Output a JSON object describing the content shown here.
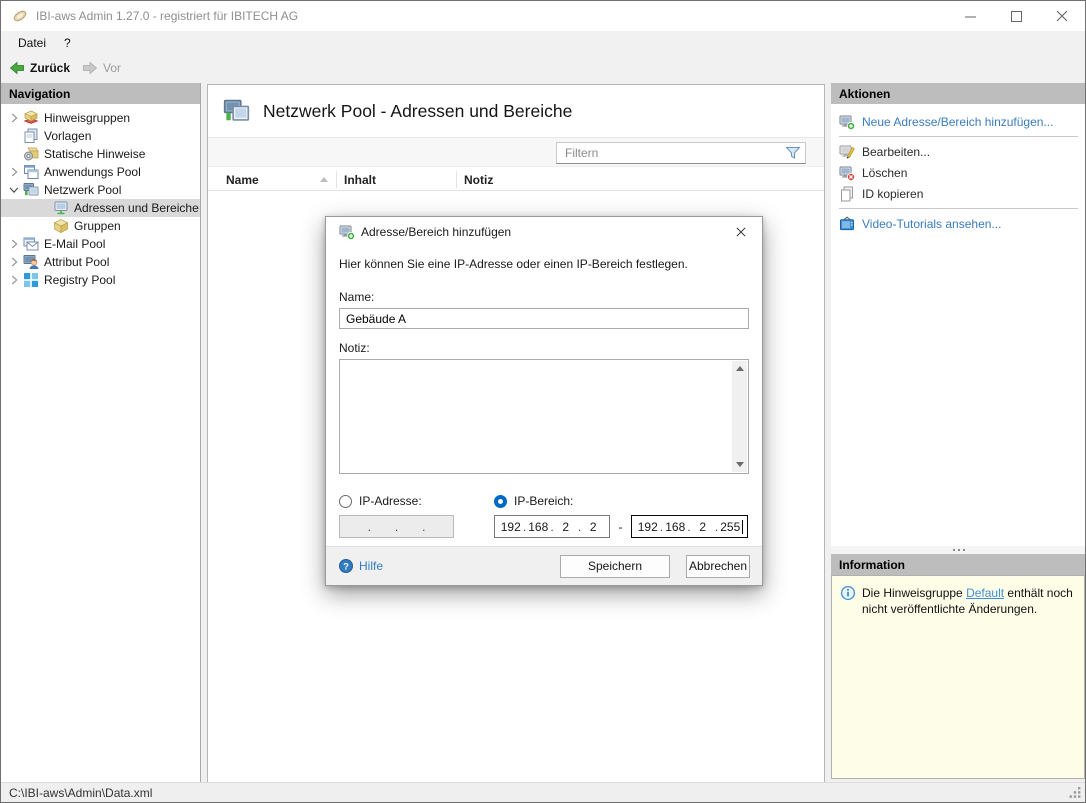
{
  "window": {
    "title": "IBI-aws Admin 1.27.0 - registriert für IBITECH AG"
  },
  "menu": {
    "items": [
      "Datei",
      "?"
    ]
  },
  "toolbar": {
    "back_label": "Zurück",
    "forward_label": "Vor"
  },
  "navigation": {
    "header": "Navigation",
    "items": [
      {
        "label": "Hinweisgruppen",
        "icon": "notice-groups-icon",
        "state": "collapsed",
        "level": 0,
        "selected": false
      },
      {
        "label": "Vorlagen",
        "icon": "templates-icon",
        "state": "none",
        "level": 0,
        "selected": false
      },
      {
        "label": "Statische Hinweise",
        "icon": "static-notices-icon",
        "state": "none",
        "level": 0,
        "selected": false
      },
      {
        "label": "Anwendungs Pool",
        "icon": "application-pool-icon",
        "state": "collapsed",
        "level": 0,
        "selected": false
      },
      {
        "label": "Netzwerk Pool",
        "icon": "network-pool-icon",
        "state": "expanded",
        "level": 0,
        "selected": false
      },
      {
        "label": "Adressen und Bereiche",
        "icon": "network-address-icon",
        "state": "none",
        "level": 1,
        "selected": true
      },
      {
        "label": "Gruppen",
        "icon": "groups-icon",
        "state": "none",
        "level": 1,
        "selected": false
      },
      {
        "label": "E-Mail Pool",
        "icon": "email-pool-icon",
        "state": "collapsed",
        "level": 0,
        "selected": false
      },
      {
        "label": "Attribut Pool",
        "icon": "attribute-pool-icon",
        "state": "collapsed",
        "level": 0,
        "selected": false
      },
      {
        "label": "Registry Pool",
        "icon": "registry-pool-icon",
        "state": "collapsed",
        "level": 0,
        "selected": false
      }
    ]
  },
  "main": {
    "title": "Netzwerk Pool - Adressen und Bereiche",
    "filter_placeholder": "Filtern",
    "columns": [
      "Name",
      "Inhalt",
      "Notiz"
    ],
    "sort_column": "Name",
    "sort_direction": "ascending"
  },
  "actions": {
    "header": "Aktionen",
    "items": [
      {
        "label": "Neue Adresse/Bereich hinzufügen...",
        "icon": "monitor-add-icon",
        "type": "link"
      },
      {
        "label": "Bearbeiten...",
        "icon": "monitor-edit-icon",
        "type": "normal"
      },
      {
        "label": "Löschen",
        "icon": "monitor-delete-icon",
        "type": "normal"
      },
      {
        "label": "ID kopieren",
        "icon": "copy-icon",
        "type": "normal"
      },
      {
        "label": "Video-Tutorials ansehen...",
        "icon": "tv-icon",
        "type": "link"
      }
    ]
  },
  "information": {
    "header": "Information",
    "text_before": "Die Hinweisgruppe ",
    "link_text": "Default",
    "text_after": " enthält noch nicht veröffentlichte Änderungen."
  },
  "dialog": {
    "title": "Adresse/Bereich hinzufügen",
    "description": "Hier können Sie eine IP-Adresse oder einen IP-Bereich festlegen.",
    "name_label": "Name:",
    "name_value": "Gebäude A",
    "note_label": "Notiz:",
    "note_value": "",
    "ip_address_label": "IP-Adresse:",
    "ip_range_label": "IP-Bereich:",
    "selected_option": "ip_range",
    "ip_separator": ".",
    "range_dash": "-",
    "ip_single": [
      "",
      "",
      "",
      ""
    ],
    "ip_from": [
      "192",
      "168",
      "2",
      "2"
    ],
    "ip_to": [
      "192",
      "168",
      "2",
      "255"
    ],
    "help_label": "Hilfe",
    "save_label": "Speichern",
    "cancel_label": "Abbrechen"
  },
  "statusbar": {
    "path": "C:\\IBI-aws\\Admin\\Data.xml"
  },
  "colors": {
    "link_blue": "#3A7BBF",
    "light_link_blue": "#3F8FD6",
    "panel_header_gray": "#BDBDBD",
    "selection_gray": "#D9D9D9",
    "info_yellow": "#FDFDE8",
    "radio_selected_blue": "#0069C8"
  }
}
